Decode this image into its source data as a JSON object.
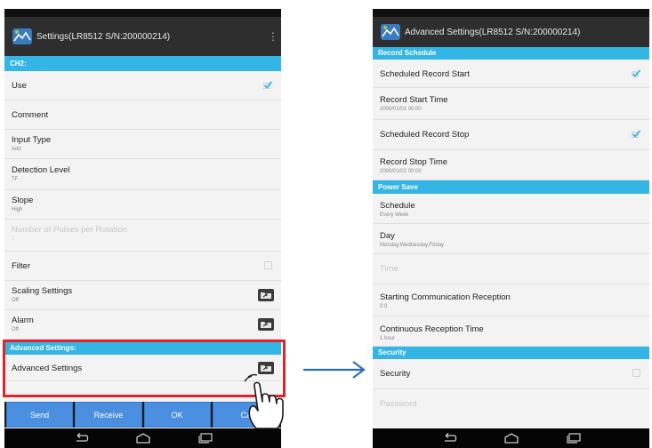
{
  "left_phone": {
    "title": "Settings(LR8512 S/N:200000214)",
    "menu_icon": "overflow-menu-icon",
    "section_ch2": "CH2:",
    "rows": {
      "use": {
        "label": "Use",
        "checked": true
      },
      "comment": {
        "label": "Comment"
      },
      "input_type": {
        "label": "Input Type",
        "value": "Add"
      },
      "detection_level": {
        "label": "Detection Level",
        "value": "TF"
      },
      "slope": {
        "label": "Slope",
        "value": "High"
      },
      "pulses": {
        "label": "Number of Pulses per Rotation",
        "value": "1"
      },
      "filter": {
        "label": "Filter",
        "checked": false
      },
      "scaling": {
        "label": "Scaling Settings",
        "value": "Off"
      },
      "alarm": {
        "label": "Alarm",
        "value": "Off"
      }
    },
    "section_advanced": "Advanced Settings:",
    "advanced_row": "Advanced Settings",
    "buttons": {
      "send": "Send",
      "receive": "Receive",
      "ok": "OK",
      "cancel": "Ca"
    }
  },
  "right_phone": {
    "title": "Advanced Settings(LR8512 S/N:200000214)",
    "section_record": "Record Schedule",
    "section_power": "Power Save",
    "section_security": "Security",
    "rows": {
      "sched_start": {
        "label": "Scheduled Record Start",
        "checked": true
      },
      "start_time": {
        "label": "Record Start Time",
        "value": "2000/01/01 00:00"
      },
      "sched_stop": {
        "label": "Scheduled Record Stop",
        "checked": true
      },
      "stop_time": {
        "label": "Record Stop Time",
        "value": "2000/01/02 00:00"
      },
      "schedule": {
        "label": "Schedule",
        "value": "Every Week"
      },
      "day": {
        "label": "Day",
        "value": "Monday,Wednesday,Friday"
      },
      "time": {
        "label": "Time"
      },
      "starting_comm": {
        "label": "Starting Communication Reception",
        "value": "0:0"
      },
      "continuous": {
        "label": "Continuous Reception Time",
        "value": "1 hour"
      },
      "security": {
        "label": "Security",
        "checked": false
      },
      "password": {
        "label": "Password"
      }
    }
  },
  "colors": {
    "accent": "#33b5e5",
    "button": "#4b8fe0",
    "highlight": "#e1232a",
    "arrow": "#2a6fb6"
  }
}
